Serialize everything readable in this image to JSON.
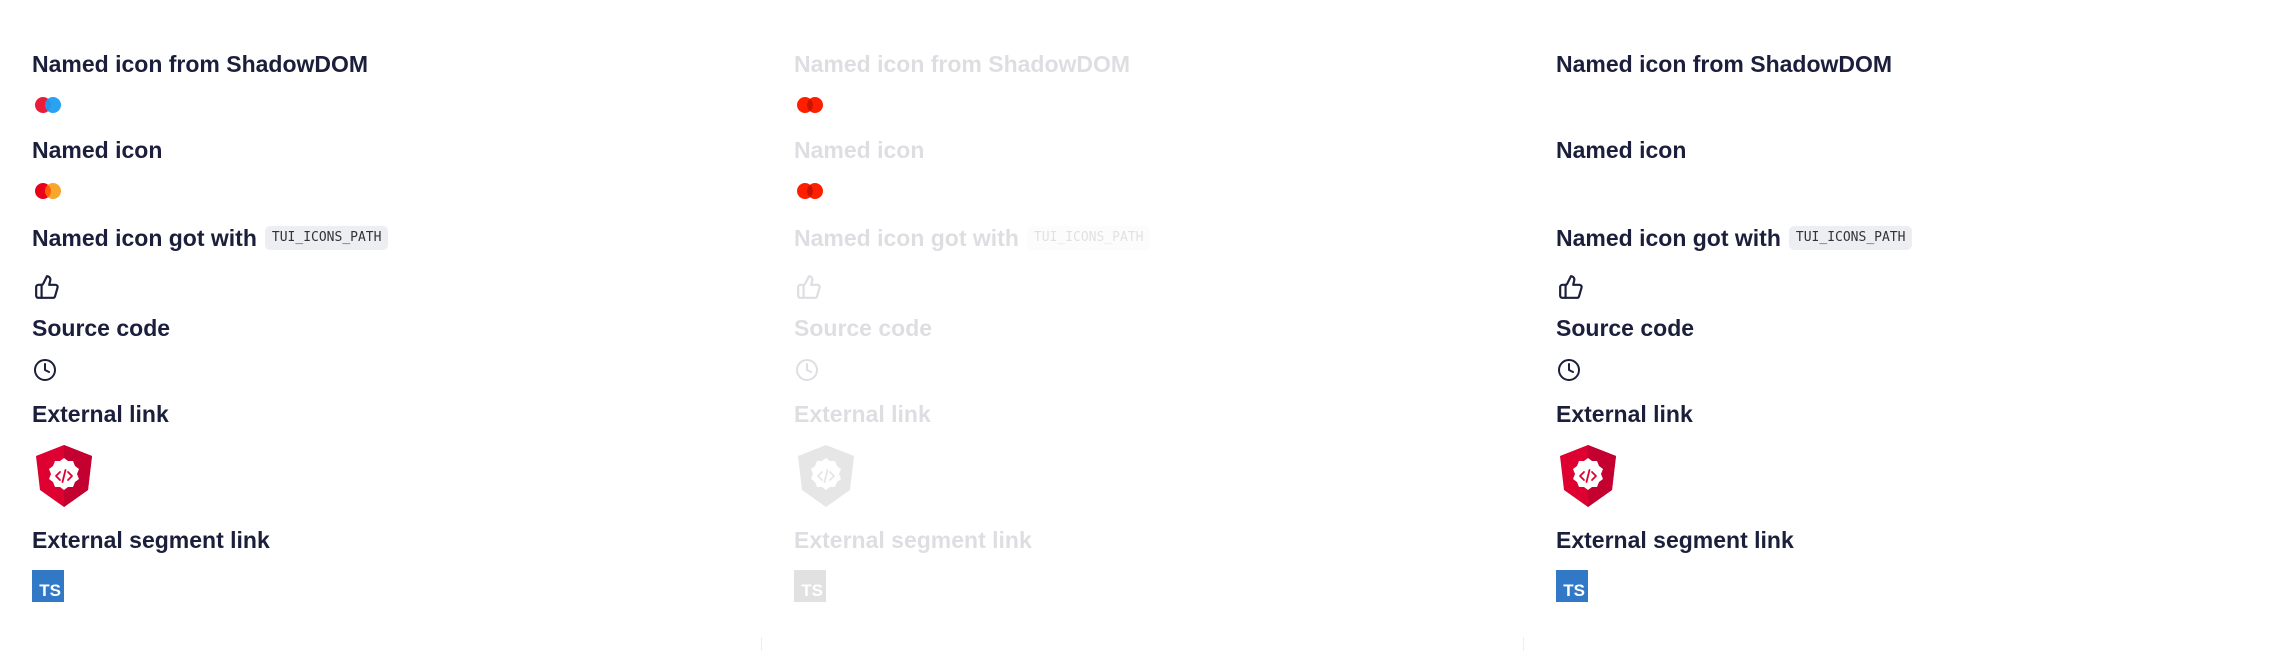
{
  "columns": [
    {
      "heading_shadow": "Named icon from ShadowDOM",
      "heading_named": "Named icon",
      "heading_path_prefix": "Named icon got with",
      "heading_path_code": "TUI_ICONS_PATH",
      "heading_source": "Source code",
      "heading_external": "External link",
      "heading_segment": "External segment link",
      "ts_label": "TS",
      "state": "normal"
    },
    {
      "heading_shadow": "Named icon from ShadowDOM",
      "heading_named": "Named icon",
      "heading_path_prefix": "Named icon got with",
      "heading_path_code": "TUI_ICONS_PATH",
      "heading_source": "Source code",
      "heading_external": "External link",
      "heading_segment": "External segment link",
      "ts_label": "TS",
      "state": "disabled"
    },
    {
      "heading_shadow": "Named icon from ShadowDOM",
      "heading_named": "Named icon",
      "heading_path_prefix": "Named icon got with",
      "heading_path_code": "TUI_ICONS_PATH",
      "heading_source": "Source code",
      "heading_external": "External link",
      "heading_segment": "External segment link",
      "ts_label": "TS",
      "state": "normal"
    }
  ],
  "icons": {
    "shadow_icon": "mastercard-blue-icon",
    "named_icon": "mastercard-icon",
    "path_icon": "thumbs-up-icon",
    "source_icon": "clock-icon",
    "external_icon": "angular-badge-icon",
    "segment_icon": "typescript-icon"
  },
  "colors": {
    "text": "#1b1f3b",
    "angular_red": "#dd0031",
    "ts_blue": "#3178c6",
    "mc_red": "#eb001b",
    "mc_orange": "#f79e1b",
    "blue": "#1e9df1"
  }
}
